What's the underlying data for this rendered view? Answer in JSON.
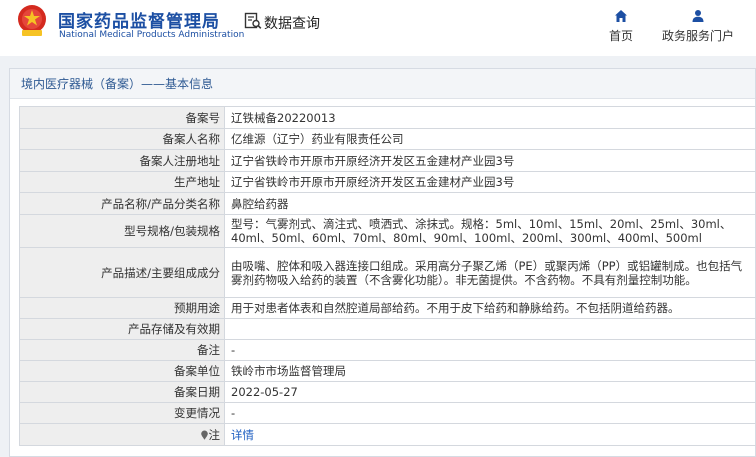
{
  "header": {
    "brand_cn": "国家药品监督管理局",
    "brand_en": "National Medical Products Administration",
    "query_label": "数据查询",
    "nav": [
      {
        "label": "首页",
        "icon": "home-icon"
      },
      {
        "label": "政务服务门户",
        "icon": "user-icon"
      }
    ]
  },
  "breadcrumb": "境内医疗器械（备案）——基本信息",
  "rows": [
    {
      "label": "备案号",
      "value": "辽铁械备20220013"
    },
    {
      "label": "备案人名称",
      "value": "亿维源（辽宁）药业有限责任公司"
    },
    {
      "label": "备案人注册地址",
      "value": "辽宁省铁岭市开原市开原经济开发区五金建材产业园3号"
    },
    {
      "label": "生产地址",
      "value": "辽宁省铁岭市开原市开原经济开发区五金建材产业园3号"
    },
    {
      "label": "产品名称/产品分类名称",
      "value": "鼻腔给药器"
    },
    {
      "label": "型号规格/包装规格",
      "value": "型号：气雾剂式、滴注式、喷洒式、涂抹式。规格：5ml、10ml、15ml、20ml、25ml、30ml、40ml、50ml、60ml、70ml、80ml、90ml、100ml、200ml、300ml、400ml、500ml"
    },
    {
      "label": "产品描述/主要组成成分",
      "value": "由吸嘴、腔体和吸入器连接口组成。采用高分子聚乙烯（PE）或聚丙烯（PP）或铝罐制成。也包括气雾剂药物吸入给药的装置（不含雾化功能）。非无菌提供。不含药物。不具有剂量控制功能。"
    },
    {
      "label": "预期用途",
      "value": "用于对患者体表和自然腔道局部给药。不用于皮下给药和静脉给药。不包括阴道给药器。"
    },
    {
      "label": "产品存储及有效期",
      "value": ""
    },
    {
      "label": "备注",
      "value": "-"
    },
    {
      "label": "备案单位",
      "value": "铁岭市市场监督管理局"
    },
    {
      "label": "备案日期",
      "value": "2022-05-27"
    },
    {
      "label": "变更情况",
      "value": "-"
    },
    {
      "label": "注",
      "value": "详情"
    }
  ],
  "colors": {
    "brand_blue": "#1c4fa3",
    "link_blue": "#1c5ec1",
    "label_bg": "#eeeeee"
  }
}
